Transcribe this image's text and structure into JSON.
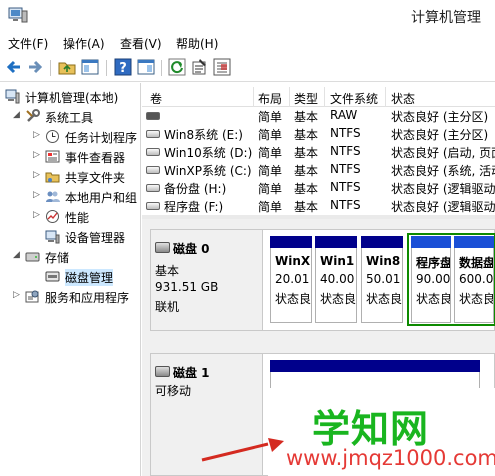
{
  "window": {
    "title": "计算机管理"
  },
  "menu": [
    "文件(F)",
    "操作(A)",
    "查看(V)",
    "帮助(H)"
  ],
  "toolbar": {
    "buttons": [
      "back-icon",
      "forward-icon",
      "up-folder-icon",
      "show-tree-icon",
      "help-icon",
      "console-icon",
      "refresh-icon",
      "properties-icon",
      "export-icon"
    ]
  },
  "tree": {
    "root": "计算机管理(本地)",
    "system_tools": "系统工具",
    "task_scheduler": "任务计划程序",
    "event_viewer": "事件查看器",
    "shared_folders": "共享文件夹",
    "local_users": "本地用户和组",
    "performance": "性能",
    "device_manager": "设备管理器",
    "storage": "存储",
    "disk_management": "磁盘管理",
    "services_apps": "服务和应用程序"
  },
  "volumes": {
    "columns": [
      "卷",
      "布局",
      "类型",
      "文件系统",
      "状态"
    ],
    "rows": [
      {
        "name": "",
        "layout": "简单",
        "type": "基本",
        "fs": "RAW",
        "status": "状态良好 (主分区)"
      },
      {
        "name": "Win8系统 (E:)",
        "layout": "简单",
        "type": "基本",
        "fs": "NTFS",
        "status": "状态良好 (主分区)"
      },
      {
        "name": "Win10系统 (D:)",
        "layout": "简单",
        "type": "基本",
        "fs": "NTFS",
        "status": "状态良好 (启动, 页面"
      },
      {
        "name": "WinXP系统 (C:)",
        "layout": "简单",
        "type": "基本",
        "fs": "NTFS",
        "status": "状态良好 (系统, 活动"
      },
      {
        "name": "备份盘 (H:)",
        "layout": "简单",
        "type": "基本",
        "fs": "NTFS",
        "status": "状态良好 (逻辑驱动"
      },
      {
        "name": "程序盘 (F:)",
        "layout": "简单",
        "type": "基本",
        "fs": "NTFS",
        "status": "状态良好 (逻辑驱动"
      }
    ]
  },
  "disk0": {
    "name": "磁盘 0",
    "type": "基本",
    "size": "931.51 GB",
    "state": "联机",
    "partitions": [
      {
        "name": "WinX",
        "size": "20.01",
        "status": "状态良"
      },
      {
        "name": "Win1",
        "size": "40.00",
        "status": "状态良"
      },
      {
        "name": "Win8",
        "size": "50.01",
        "status": "状态良"
      },
      {
        "name": "程序盘",
        "size": "90.00",
        "status": "状态良"
      },
      {
        "name": "数据盘",
        "size": "600.0",
        "status": "状态良"
      }
    ]
  },
  "disk1": {
    "name": "磁盘 1",
    "type": "可移动",
    "partition": {
      "line1": "1",
      "line2": "状"
    }
  },
  "watermark": {
    "brand": "学知网",
    "url": "www.jmqz1000.com"
  }
}
